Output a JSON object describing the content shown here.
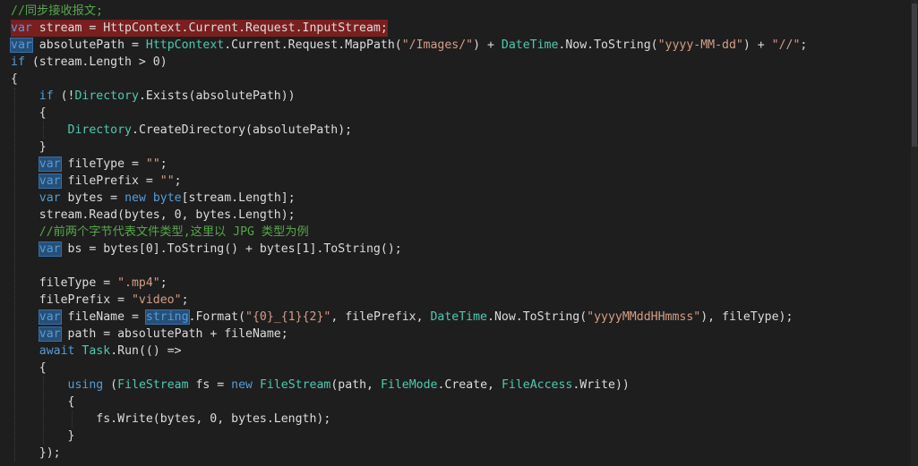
{
  "editor": {
    "colors": {
      "background": "#1e1e1e",
      "keyword": "#569cd6",
      "type": "#4ec9b0",
      "string": "#d69d85",
      "comment": "#57a64a",
      "plain": "#dcdcdc",
      "highlight_line": "#7a1f1f",
      "highlight_var": "#264f78"
    },
    "lines": [
      {
        "tokens": [
          {
            "k": "cm",
            "t": "//同步接收报文;"
          }
        ]
      },
      {
        "tokens": [
          {
            "k": "kw",
            "t": "var"
          },
          {
            "k": "pl",
            "t": " stream = HttpContext.Current.Request.InputStream;"
          }
        ],
        "highlight": true
      },
      {
        "tokens": [
          {
            "k": "kw",
            "t": "var",
            "hl": true
          },
          {
            "k": "pl",
            "t": " absolutePath = "
          },
          {
            "k": "ty",
            "t": "HttpContext"
          },
          {
            "k": "pl",
            "t": ".Current.Request.MapPath("
          },
          {
            "k": "st",
            "t": "\"/Images/\""
          },
          {
            "k": "pl",
            "t": ") + "
          },
          {
            "k": "ty",
            "t": "DateTime"
          },
          {
            "k": "pl",
            "t": ".Now.ToString("
          },
          {
            "k": "st",
            "t": "\"yyyy-MM-dd\""
          },
          {
            "k": "pl",
            "t": ") + "
          },
          {
            "k": "st",
            "t": "\"//\""
          },
          {
            "k": "pl",
            "t": ";"
          }
        ]
      },
      {
        "tokens": [
          {
            "k": "kw",
            "t": "if"
          },
          {
            "k": "pl",
            "t": " (stream.Length > 0)"
          }
        ]
      },
      {
        "tokens": [
          {
            "k": "pl",
            "t": "{"
          }
        ]
      },
      {
        "tokens": [
          {
            "k": "pl",
            "t": "    "
          },
          {
            "k": "kw",
            "t": "if"
          },
          {
            "k": "pl",
            "t": " (!"
          },
          {
            "k": "ty",
            "t": "Directory"
          },
          {
            "k": "pl",
            "t": ".Exists(absolutePath))"
          }
        ]
      },
      {
        "tokens": [
          {
            "k": "pl",
            "t": "    {"
          }
        ]
      },
      {
        "tokens": [
          {
            "k": "pl",
            "t": "        "
          },
          {
            "k": "ty",
            "t": "Directory"
          },
          {
            "k": "pl",
            "t": ".CreateDirectory(absolutePath);"
          }
        ]
      },
      {
        "tokens": [
          {
            "k": "pl",
            "t": "    }"
          }
        ]
      },
      {
        "tokens": [
          {
            "k": "pl",
            "t": "    "
          },
          {
            "k": "kw",
            "t": "var",
            "hl": true
          },
          {
            "k": "pl",
            "t": " fileType = "
          },
          {
            "k": "st",
            "t": "\"\""
          },
          {
            "k": "pl",
            "t": ";"
          }
        ]
      },
      {
        "tokens": [
          {
            "k": "pl",
            "t": "    "
          },
          {
            "k": "kw",
            "t": "var",
            "hl": true
          },
          {
            "k": "pl",
            "t": " filePrefix = "
          },
          {
            "k": "st",
            "t": "\"\""
          },
          {
            "k": "pl",
            "t": ";"
          }
        ]
      },
      {
        "tokens": [
          {
            "k": "pl",
            "t": "    "
          },
          {
            "k": "kw",
            "t": "var"
          },
          {
            "k": "pl",
            "t": " bytes = "
          },
          {
            "k": "kw",
            "t": "new"
          },
          {
            "k": "pl",
            "t": " "
          },
          {
            "k": "kw",
            "t": "byte"
          },
          {
            "k": "pl",
            "t": "[stream.Length];"
          }
        ]
      },
      {
        "tokens": [
          {
            "k": "pl",
            "t": "    stream.Read(bytes, 0, bytes.Length);"
          }
        ]
      },
      {
        "tokens": [
          {
            "k": "pl",
            "t": "    "
          },
          {
            "k": "cm",
            "t": "//前两个字节代表文件类型,这里以 JPG 类型为例"
          }
        ]
      },
      {
        "tokens": [
          {
            "k": "pl",
            "t": "    "
          },
          {
            "k": "kw",
            "t": "var",
            "hl": true
          },
          {
            "k": "pl",
            "t": " bs = bytes[0].ToString() + bytes[1].ToString();"
          }
        ]
      },
      {
        "tokens": [
          {
            "k": "pl",
            "t": ""
          }
        ]
      },
      {
        "tokens": [
          {
            "k": "pl",
            "t": "    fileType = "
          },
          {
            "k": "st",
            "t": "\".mp4\""
          },
          {
            "k": "pl",
            "t": ";"
          }
        ]
      },
      {
        "tokens": [
          {
            "k": "pl",
            "t": "    filePrefix = "
          },
          {
            "k": "st",
            "t": "\"video\""
          },
          {
            "k": "pl",
            "t": ";"
          }
        ]
      },
      {
        "tokens": [
          {
            "k": "pl",
            "t": "    "
          },
          {
            "k": "kw",
            "t": "var",
            "hl": true
          },
          {
            "k": "pl",
            "t": " fileName = "
          },
          {
            "k": "kw",
            "t": "string",
            "hl": true
          },
          {
            "k": "pl",
            "t": ".Format("
          },
          {
            "k": "st",
            "t": "\"{0}_{1}{2}\""
          },
          {
            "k": "pl",
            "t": ", filePrefix, "
          },
          {
            "k": "ty",
            "t": "DateTime"
          },
          {
            "k": "pl",
            "t": ".Now.ToString("
          },
          {
            "k": "st",
            "t": "\"yyyyMMddHHmmss\""
          },
          {
            "k": "pl",
            "t": "), fileType);"
          }
        ]
      },
      {
        "tokens": [
          {
            "k": "pl",
            "t": "    "
          },
          {
            "k": "kw",
            "t": "var",
            "hl": true
          },
          {
            "k": "pl",
            "t": " path = absolutePath + fileName;"
          }
        ]
      },
      {
        "tokens": [
          {
            "k": "pl",
            "t": "    "
          },
          {
            "k": "kw",
            "t": "await"
          },
          {
            "k": "pl",
            "t": " "
          },
          {
            "k": "ty",
            "t": "Task"
          },
          {
            "k": "pl",
            "t": ".Run(() =>"
          }
        ]
      },
      {
        "tokens": [
          {
            "k": "pl",
            "t": "    {"
          }
        ]
      },
      {
        "tokens": [
          {
            "k": "pl",
            "t": "        "
          },
          {
            "k": "kw",
            "t": "using"
          },
          {
            "k": "pl",
            "t": " ("
          },
          {
            "k": "ty",
            "t": "FileStream"
          },
          {
            "k": "pl",
            "t": " fs = "
          },
          {
            "k": "kw",
            "t": "new"
          },
          {
            "k": "pl",
            "t": " "
          },
          {
            "k": "ty",
            "t": "FileStream"
          },
          {
            "k": "pl",
            "t": "(path, "
          },
          {
            "k": "ty",
            "t": "FileMode"
          },
          {
            "k": "pl",
            "t": ".Create, "
          },
          {
            "k": "ty",
            "t": "FileAccess"
          },
          {
            "k": "pl",
            "t": ".Write))"
          }
        ]
      },
      {
        "tokens": [
          {
            "k": "pl",
            "t": "        {"
          }
        ]
      },
      {
        "tokens": [
          {
            "k": "pl",
            "t": "            fs.Write(bytes, 0, bytes.Length);"
          }
        ]
      },
      {
        "tokens": [
          {
            "k": "pl",
            "t": "        }"
          }
        ]
      },
      {
        "tokens": [
          {
            "k": "pl",
            "t": "    });"
          }
        ]
      }
    ]
  }
}
